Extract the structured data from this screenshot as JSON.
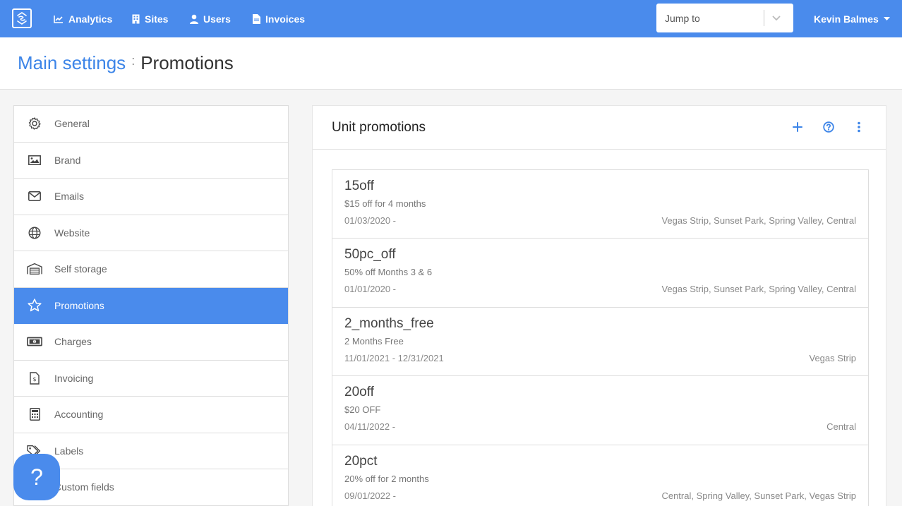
{
  "nav": {
    "items": [
      {
        "label": "Analytics",
        "icon": "chart-icon"
      },
      {
        "label": "Sites",
        "icon": "building-icon"
      },
      {
        "label": "Users",
        "icon": "user-icon"
      },
      {
        "label": "Invoices",
        "icon": "file-icon"
      }
    ],
    "jump_placeholder": "Jump to",
    "user_name": "Kevin Balmes"
  },
  "breadcrumb": {
    "parent": "Main settings",
    "separator": ":",
    "current": "Promotions"
  },
  "sidebar": {
    "items": [
      {
        "label": "General",
        "icon": "gear-icon"
      },
      {
        "label": "Brand",
        "icon": "image-icon"
      },
      {
        "label": "Emails",
        "icon": "envelope-icon"
      },
      {
        "label": "Website",
        "icon": "globe-icon"
      },
      {
        "label": "Self storage",
        "icon": "warehouse-icon"
      },
      {
        "label": "Promotions",
        "icon": "star-icon",
        "active": true
      },
      {
        "label": "Charges",
        "icon": "money-icon"
      },
      {
        "label": "Invoicing",
        "icon": "invoice-icon"
      },
      {
        "label": "Accounting",
        "icon": "calculator-icon"
      },
      {
        "label": "Labels",
        "icon": "tags-icon"
      },
      {
        "label": "Custom fields",
        "icon": "fields-icon"
      }
    ]
  },
  "card": {
    "title": "Unit promotions",
    "actions": [
      "add-icon",
      "help-circle-icon",
      "more-vertical-icon"
    ]
  },
  "promotions": [
    {
      "name": "15off",
      "description": "$15 off for 4 months",
      "dates": "01/03/2020 -",
      "sites": "Vegas Strip, Sunset Park, Spring Valley, Central"
    },
    {
      "name": "50pc_off",
      "description": "50% off Months 3 & 6",
      "dates": "01/01/2020 -",
      "sites": "Vegas Strip, Sunset Park, Spring Valley, Central"
    },
    {
      "name": "2_months_free",
      "description": "2 Months Free",
      "dates": "11/01/2021 - 12/31/2021",
      "sites": "Vegas Strip"
    },
    {
      "name": "20off",
      "description": "$20 OFF",
      "dates": "04/11/2022 -",
      "sites": "Central"
    },
    {
      "name": "20pct",
      "description": "20% off for 2 months",
      "dates": "09/01/2022 -",
      "sites": "Central, Spring Valley, Sunset Park, Vegas Strip"
    }
  ],
  "help_button": "?",
  "colors": {
    "accent": "#4a8bec",
    "link": "#3d85e8"
  }
}
